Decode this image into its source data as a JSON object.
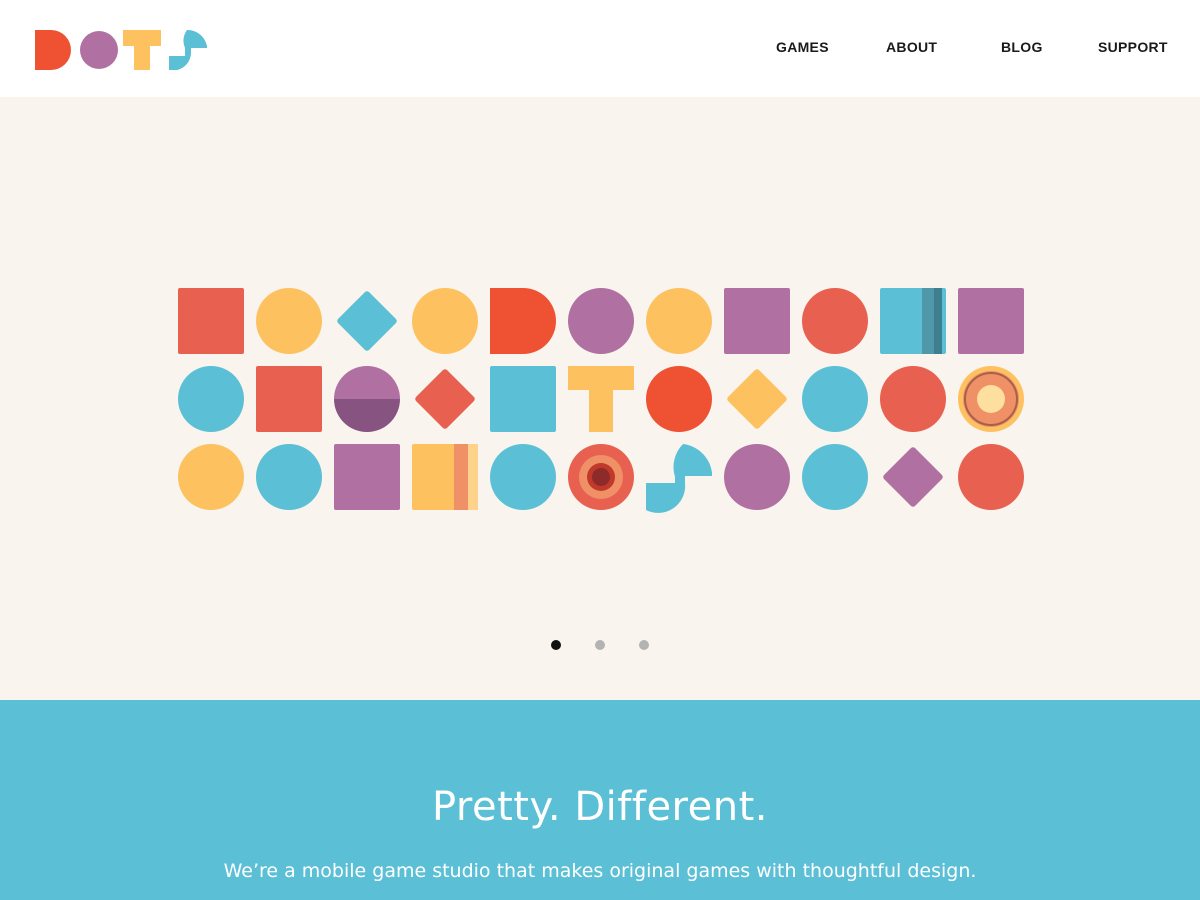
{
  "brand": {
    "logo_text": "DOTS",
    "colors": {
      "red": "#e8604f",
      "orange_red": "#ee5233",
      "purple": "#b070a2",
      "dark_purple": "#875381",
      "yellow": "#fdc25f",
      "blue": "#5bbfd6",
      "dark_teal": "#3d7f8f",
      "orange": "#ef9066",
      "dark_red": "#8d2a2a"
    }
  },
  "nav": {
    "items": [
      {
        "label": "GAMES"
      },
      {
        "label": "ABOUT"
      },
      {
        "label": "BLOG"
      },
      {
        "label": "SUPPORT"
      }
    ]
  },
  "hero": {
    "grid": [
      [
        "red-square",
        "yellow-circle",
        "blue-diamond",
        "yellow-circle",
        "orange-red-d",
        "purple-circle",
        "yellow-circle",
        "purple-square",
        "red-circle",
        "blue-striped-square",
        "purple-square"
      ],
      [
        "blue-circle",
        "red-square",
        "purple-half-circle",
        "red-diamond",
        "blue-square",
        "yellow-t",
        "orange-red-circle",
        "yellow-diamond",
        "blue-circle",
        "red-circle",
        "yellow-ring-circle"
      ],
      [
        "yellow-circle",
        "blue-circle",
        "purple-square",
        "yellow-striped-square",
        "blue-circle",
        "red-target-circle",
        "blue-s",
        "purple-circle",
        "blue-circle",
        "purple-diamond",
        "red-circle"
      ]
    ],
    "slides": [
      {
        "active": true
      },
      {
        "active": false
      },
      {
        "active": false
      }
    ]
  },
  "intro": {
    "headline": "Pretty. Different.",
    "tagline": "We’re a mobile game studio that makes original games with thoughtful design."
  }
}
